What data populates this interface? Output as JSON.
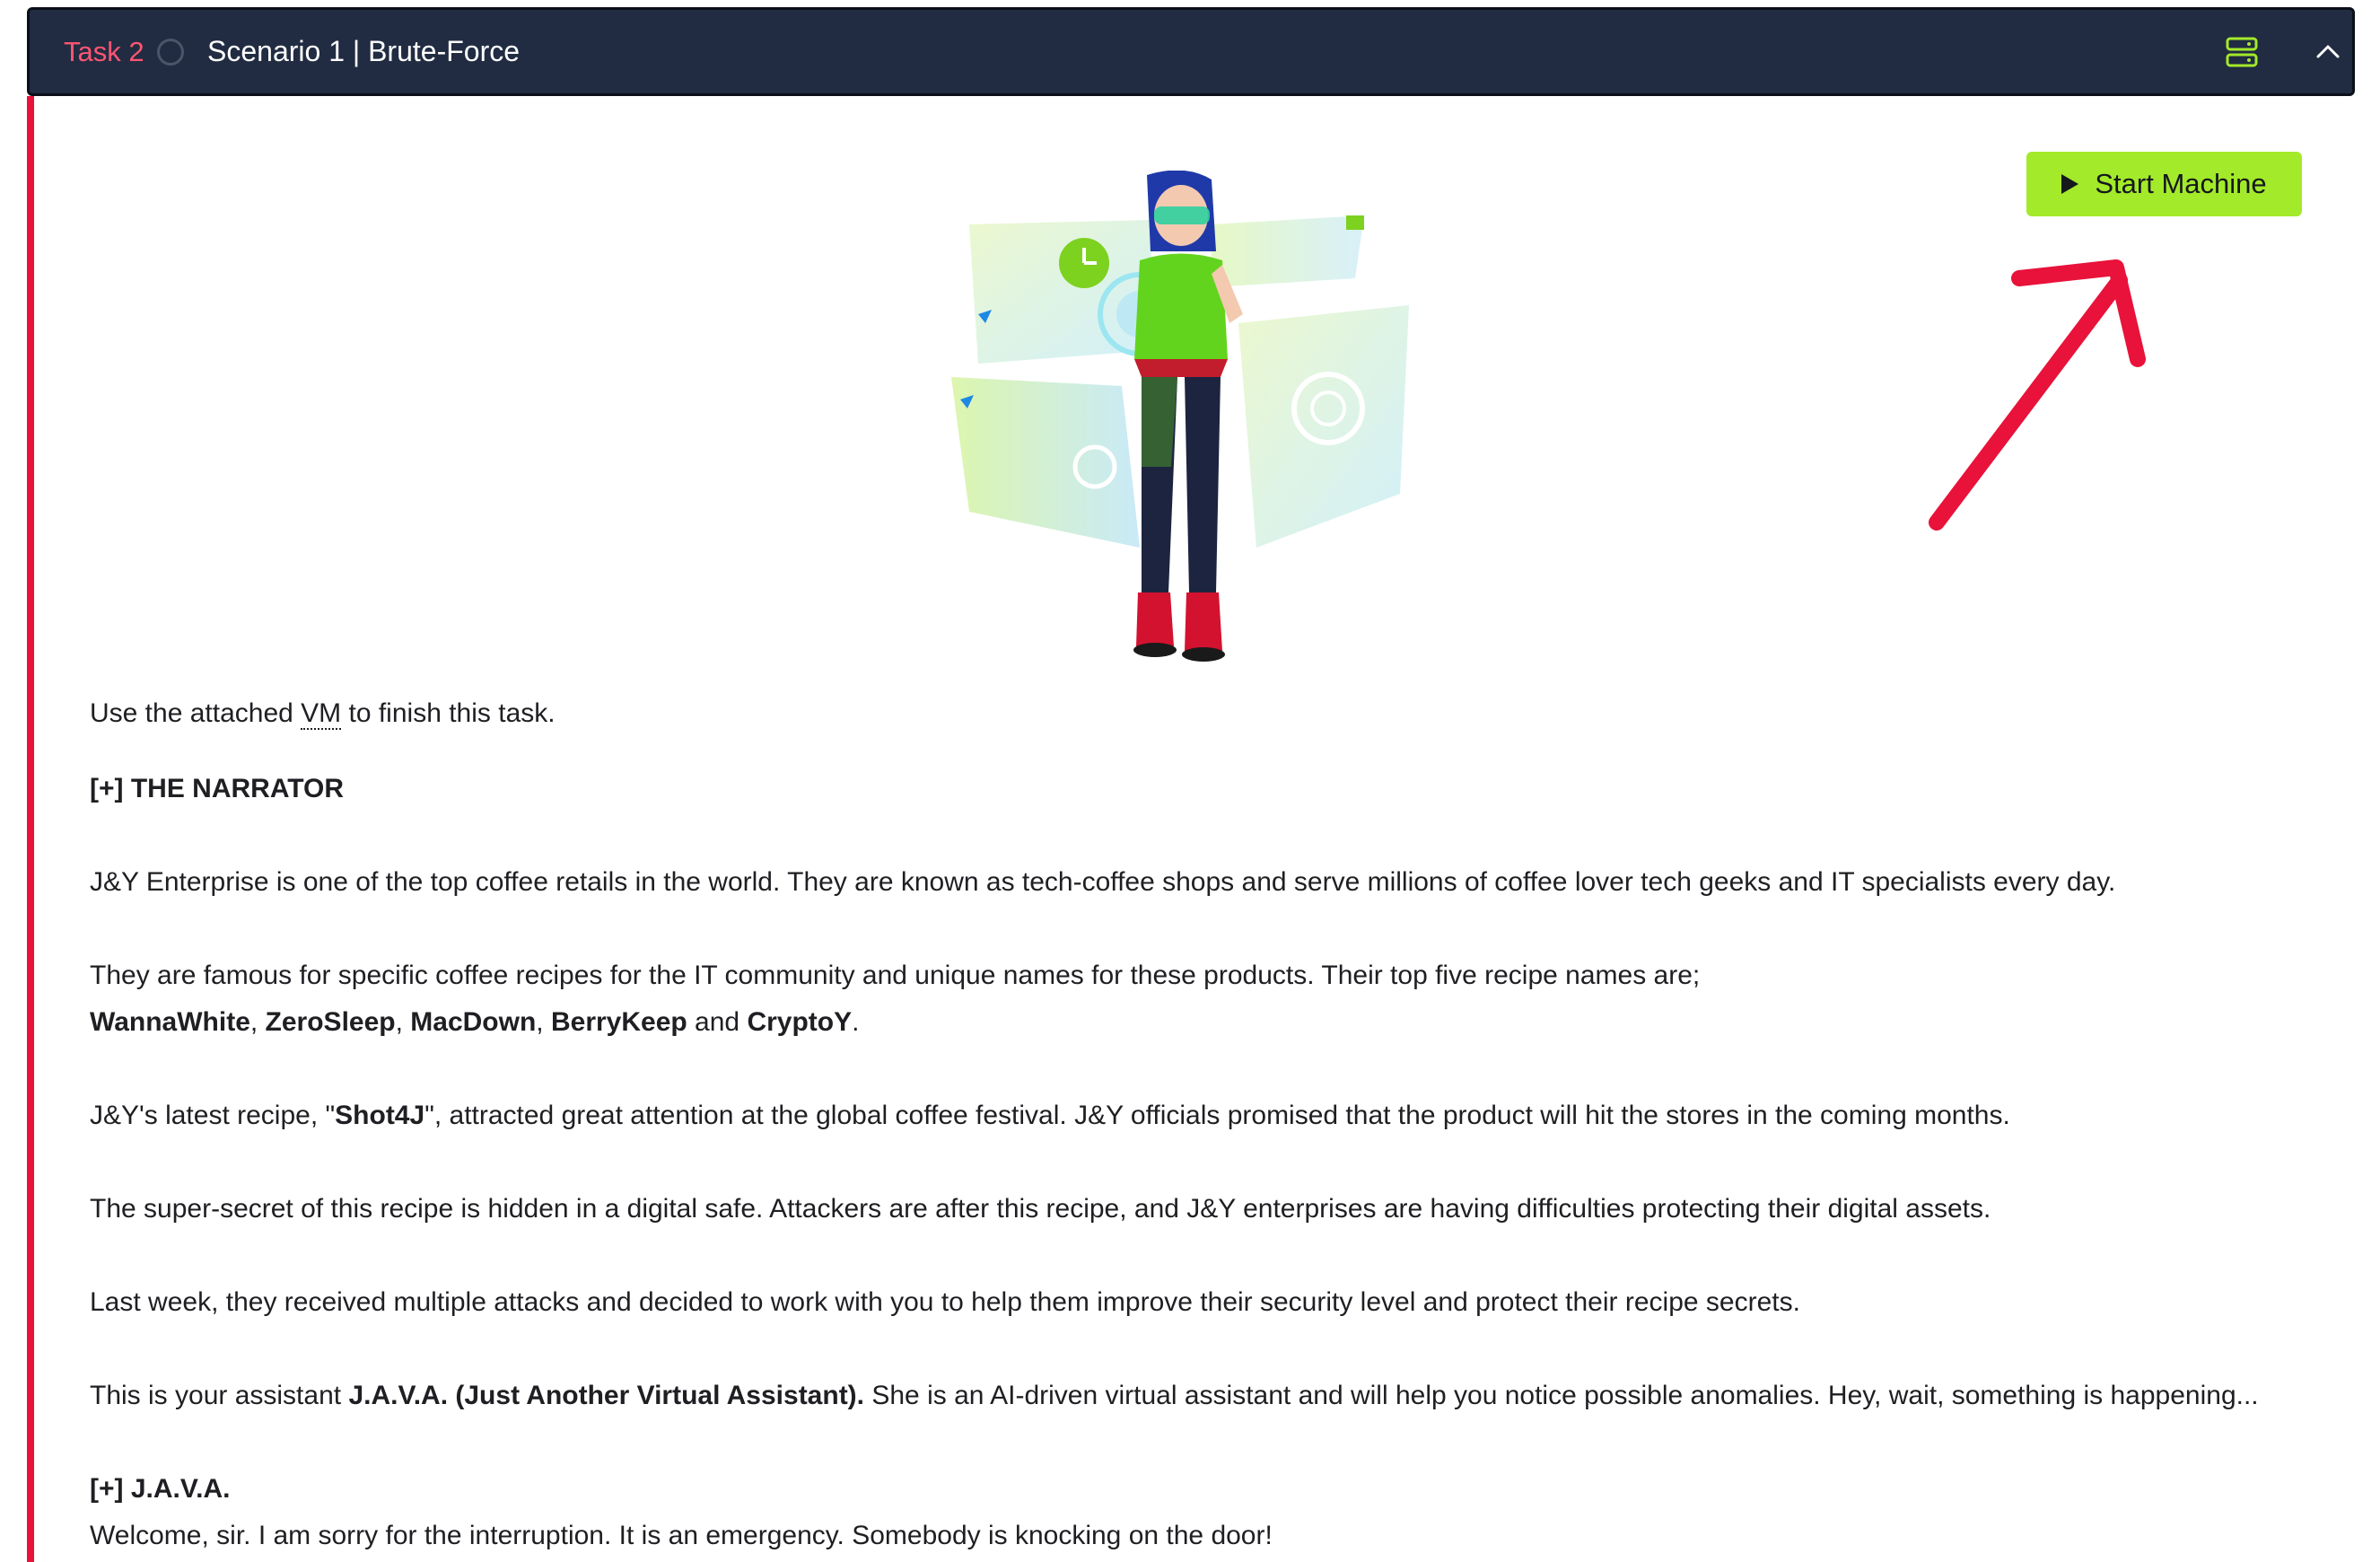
{
  "header": {
    "task_label": "Task 2",
    "title": "Scenario 1 | Brute-Force",
    "icons": {
      "status": "circle-icon",
      "server": "server-icon",
      "collapse": "chevron-up-icon"
    }
  },
  "colors": {
    "accent_red": "#e8123a",
    "task_red": "#ff5573",
    "header_bg": "#212c42",
    "button_green": "#a3ea2a"
  },
  "start_machine": {
    "label": "Start Machine",
    "icon": "play-icon"
  },
  "intro": {
    "before": "Use the attached ",
    "abbr": "VM",
    "after": " to finish this task."
  },
  "narrator": {
    "heading": "[+] THE NARRATOR",
    "p1": "J&Y Enterprise is one of the top coffee retails in the world. They are known as tech-coffee shops and serve millions of coffee lover tech geeks and IT specialists every day.",
    "p2": "They are famous for specific coffee recipes for the IT community and unique names for these products. Their top five recipe names are;",
    "recipes": [
      "WannaWhite",
      "ZeroSleep",
      "MacDown",
      "BerryKeep",
      "CryptoY"
    ],
    "sep": ", ",
    "and": " and ",
    "period": ".",
    "p3_before": "J&Y's latest recipe, \"",
    "p3_bold": "Shot4J",
    "p3_after": "\", attracted great attention at the global coffee festival. J&Y officials promised that the product will hit the stores in the coming months.",
    "p4": "The super-secret of this recipe is hidden in a digital safe. Attackers are after this recipe, and J&Y enterprises are having difficulties protecting their digital assets.",
    "p5": "Last week, they received multiple attacks and decided to work with you to help them improve their security level and protect their recipe secrets.",
    "p6_before": "This is your assistant ",
    "p6_bold": "J.A.V.A. (Just Another Virtual Assistant).",
    "p6_after": " She is an AI-driven virtual assistant and will help you notice possible anomalies. Hey, wait, something is happening..."
  },
  "java": {
    "heading": "[+] J.A.V.A.",
    "p1": "Welcome, sir. I am sorry for the interruption. It is an emergency. Somebody is knocking on the door!"
  }
}
